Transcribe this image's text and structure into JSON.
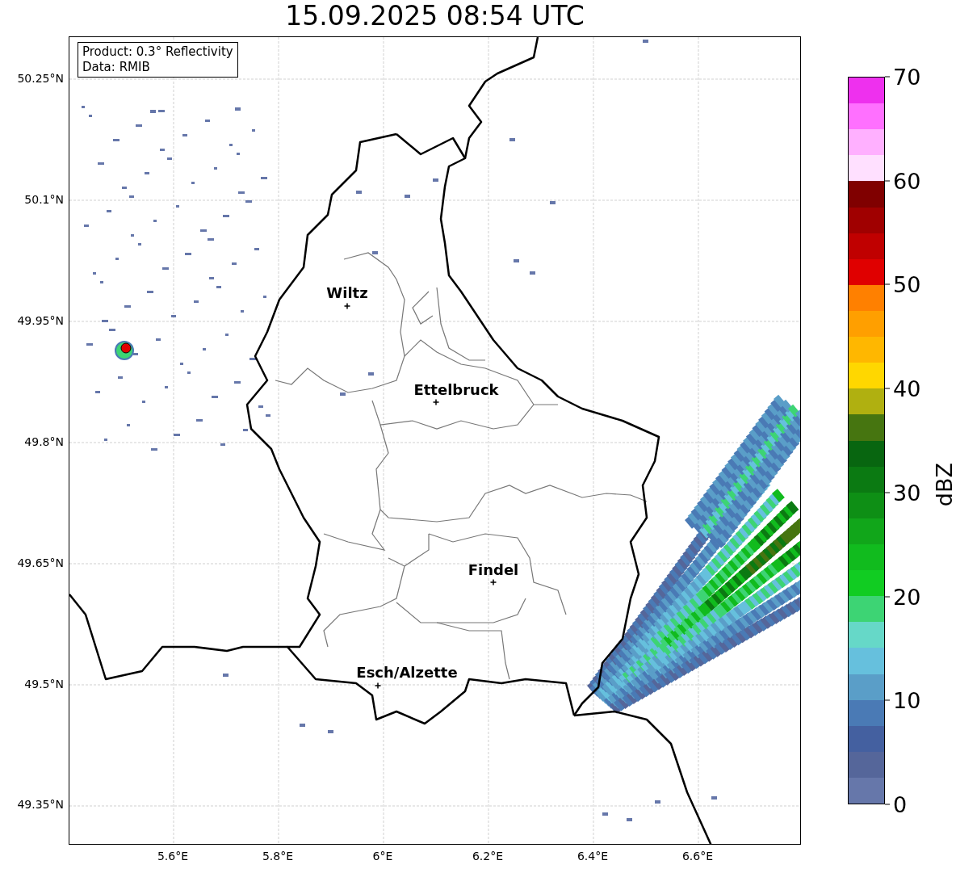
{
  "title": "15.09.2025 08:54 UTC",
  "info_box": [
    "Product: 0.3° Reflectivity",
    "Data: RMIB"
  ],
  "cities": [
    {
      "name": "Wiltz"
    },
    {
      "name": "Ettelbruck"
    },
    {
      "name": "Findel"
    },
    {
      "name": "Esch/Alzette"
    }
  ],
  "x_ticks": [
    "5.6°E",
    "5.8°E",
    "6°E",
    "6.2°E",
    "6.4°E",
    "6.6°E"
  ],
  "y_ticks": [
    "50.25°N",
    "50.1°N",
    "49.95°N",
    "49.8°N",
    "49.65°N",
    "49.5°N",
    "49.35°N"
  ],
  "colorbar": {
    "label": "dBZ",
    "ticks": [
      "70",
      "60",
      "50",
      "40",
      "30",
      "20",
      "10",
      "0"
    ],
    "bins": [
      {
        "color": "#ee30ee"
      },
      {
        "color": "#ff70ff"
      },
      {
        "color": "#ffb0ff"
      },
      {
        "color": "#ffe0ff"
      },
      {
        "color": "#800000"
      },
      {
        "color": "#a00000"
      },
      {
        "color": "#c00000"
      },
      {
        "color": "#e00000"
      },
      {
        "color": "#ff8000"
      },
      {
        "color": "#ff9f00"
      },
      {
        "color": "#ffb700"
      },
      {
        "color": "#ffd700"
      },
      {
        "color": "#b0b010"
      },
      {
        "color": "#467510"
      },
      {
        "color": "#086610"
      },
      {
        "color": "#0b7a12"
      },
      {
        "color": "#0e8f15"
      },
      {
        "color": "#11a61a"
      },
      {
        "color": "#11bb1e"
      },
      {
        "color": "#11cc22"
      },
      {
        "color": "#3dd474"
      },
      {
        "color": "#66d8c8"
      },
      {
        "color": "#66c0dd"
      },
      {
        "color": "#5a9ec8"
      },
      {
        "color": "#4a7ab5"
      },
      {
        "color": "#4460a0"
      },
      {
        "color": "#55669a"
      },
      {
        "color": "#6677aa"
      }
    ]
  }
}
